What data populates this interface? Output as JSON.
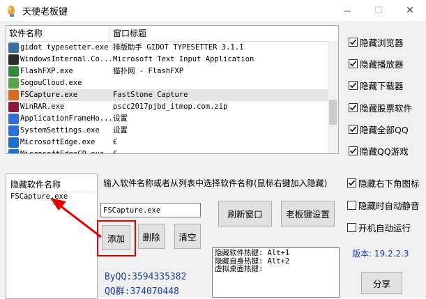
{
  "window": {
    "title": "天使老板键",
    "minimize_glyph": "—",
    "maximize_glyph": "☐",
    "close_glyph": "✕"
  },
  "process_list": {
    "columns": [
      "软件名称",
      "窗口标题"
    ],
    "rows": [
      {
        "name": "gidot typesetter.exe",
        "title": "排版助手 GIDOT TYPESETTER 3.1.1",
        "icon": "gidot-icon",
        "color": "#3a6ea5"
      },
      {
        "name": "WindowsInternal.Co...",
        "title": "Microsoft Text Input Application",
        "icon": "windows-app-icon",
        "color": "#2b2b2b"
      },
      {
        "name": "FlashFXP.exe",
        "title": "猫扑网 - FlashFXP",
        "icon": "flashfxp-icon",
        "color": "#2e8b3a"
      },
      {
        "name": "SogouCloud.exe",
        "title": "",
        "icon": "sogou-icon",
        "color": "#56a54a"
      },
      {
        "name": "FSCapture.exe",
        "title": "FastStone Capture",
        "icon": "fscapture-icon",
        "color": "#d96a20"
      },
      {
        "name": "WinRAR.exe",
        "title": "pscc2017pjbd_itmop.com.zip",
        "icon": "winrar-icon",
        "color": "#8b1a3a"
      },
      {
        "name": "ApplicationFrameHo...",
        "title": "设置",
        "icon": "app-frame-icon",
        "color": "#2a6fd8"
      },
      {
        "name": "SystemSettings.exe",
        "title": "设置",
        "icon": "settings-icon",
        "color": "#2a6fd8"
      },
      {
        "name": "MicrosoftEdge.exe",
        "title": "€",
        "icon": "edge-icon",
        "color": "#1f6fd0"
      },
      {
        "name": "MicrosoftEdgeCP.exe",
        "title": "€",
        "icon": "edge-icon",
        "color": "#1f6fd0"
      }
    ],
    "selected_index": 4
  },
  "options_top": [
    {
      "label": "隐藏浏览器",
      "checked": true
    },
    {
      "label": "隐藏播放器",
      "checked": true
    },
    {
      "label": "隐藏下载器",
      "checked": true
    },
    {
      "label": "隐藏股票软件",
      "checked": true
    },
    {
      "label": "隐藏全部QQ",
      "checked": true
    },
    {
      "label": "隐藏QQ游戏",
      "checked": true
    }
  ],
  "hidden_list": {
    "header": "隐藏软件名称",
    "items": [
      "FSCapture.exe"
    ]
  },
  "input_hint": "输入软件名称或者从列表中选择软件名称(鼠标右键加入隐藏)",
  "software_input": {
    "value": "FSCapture.exe"
  },
  "buttons": {
    "refresh": "刷新窗口",
    "boss_key_settings": "老板键设置",
    "add": "添加",
    "delete": "删除",
    "clear": "清空",
    "share": "分享"
  },
  "options_right": [
    {
      "label": "隐藏右下角图标",
      "checked": true
    },
    {
      "label": "隐藏时自动静音",
      "checked": false
    },
    {
      "label": "开机自动运行",
      "checked": false
    }
  ],
  "hotkeys": [
    "隐藏软件热键: Alt+1",
    "隐藏自身热键: Alt+2",
    "虚拟桌面热键:"
  ],
  "version": "版本: 19.2.2.3",
  "contact": {
    "qq": "ByQQ:3594335382",
    "group": "QQ群:374070448"
  },
  "colors": {
    "accent_red": "#e60000",
    "link_blue": "#1f3fa0",
    "selection": "#e5e5e5"
  }
}
